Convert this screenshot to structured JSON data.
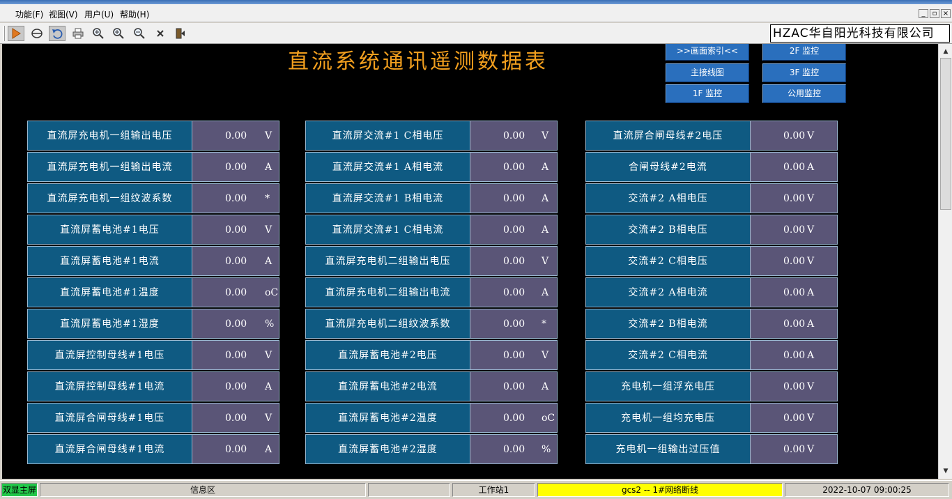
{
  "menu": {
    "items": [
      "功能(F)",
      "视图(V)",
      "用户(U)",
      "帮助(H)"
    ],
    "window_controls": [
      "_",
      "▫",
      "×"
    ]
  },
  "toolbar": {
    "company": "HZAC华自阳光科技有限公司",
    "buttons": [
      "run-icon",
      "view-icon",
      "undo-icon",
      "print-icon",
      "zoom-icon",
      "zoom-in-icon",
      "zoom-out-icon",
      "close-x-icon",
      "exit-door-icon"
    ]
  },
  "page": {
    "title": "直流系统通讯遥测数据表"
  },
  "nav": {
    "index": ">>画面索引<<",
    "floor2": "2F 监控",
    "main_wiring": "主接线图",
    "floor3": "3F 监控",
    "floor1": "1F 监控",
    "public": "公用监控"
  },
  "tables": [
    {
      "rows": [
        {
          "label": "直流屏充电机一组输出电压",
          "value": "0.00",
          "unit": "V"
        },
        {
          "label": "直流屏充电机一组输出电流",
          "value": "0.00",
          "unit": "A"
        },
        {
          "label": "直流屏充电机一组纹波系数",
          "value": "0.00",
          "unit": "*"
        },
        {
          "label": "直流屏蓄电池#1电压",
          "value": "0.00",
          "unit": "V"
        },
        {
          "label": "直流屏蓄电池#1电流",
          "value": "0.00",
          "unit": "A"
        },
        {
          "label": "直流屏蓄电池#1温度",
          "value": "0.00",
          "unit": "oC"
        },
        {
          "label": "直流屏蓄电池#1湿度",
          "value": "0.00",
          "unit": "%"
        },
        {
          "label": "直流屏控制母线#1电压",
          "value": "0.00",
          "unit": "V"
        },
        {
          "label": "直流屏控制母线#1电流",
          "value": "0.00",
          "unit": "A"
        },
        {
          "label": "直流屏合闸母线#1电压",
          "value": "0.00",
          "unit": "V"
        },
        {
          "label": "直流屏合闸母线#1电流",
          "value": "0.00",
          "unit": "A"
        }
      ]
    },
    {
      "rows": [
        {
          "label": "直流屏交流#1 C相电压",
          "value": "0.00",
          "unit": "V"
        },
        {
          "label": "直流屏交流#1 A相电流",
          "value": "0.00",
          "unit": "A"
        },
        {
          "label": "直流屏交流#1 B相电流",
          "value": "0.00",
          "unit": "A"
        },
        {
          "label": "直流屏交流#1 C相电流",
          "value": "0.00",
          "unit": "A"
        },
        {
          "label": "直流屏充电机二组输出电压",
          "value": "0.00",
          "unit": "V"
        },
        {
          "label": "直流屏充电机二组输出电流",
          "value": "0.00",
          "unit": "A"
        },
        {
          "label": "直流屏充电机二组纹波系数",
          "value": "0.00",
          "unit": "*"
        },
        {
          "label": "直流屏蓄电池#2电压",
          "value": "0.00",
          "unit": "V"
        },
        {
          "label": "直流屏蓄电池#2电流",
          "value": "0.00",
          "unit": "A"
        },
        {
          "label": "直流屏蓄电池#2温度",
          "value": "0.00",
          "unit": "oC"
        },
        {
          "label": "直流屏蓄电池#2湿度",
          "value": "0.00",
          "unit": "%"
        }
      ]
    },
    {
      "rows": [
        {
          "label": "直流屏合闸母线#2电压",
          "value": "0.00",
          "unit": "V"
        },
        {
          "label": "合闸母线#2电流",
          "value": "0.00",
          "unit": "A"
        },
        {
          "label": "交流#2 A相电压",
          "value": "0.00",
          "unit": "V"
        },
        {
          "label": "交流#2 B相电压",
          "value": "0.00",
          "unit": "V"
        },
        {
          "label": "交流#2 C相电压",
          "value": "0.00",
          "unit": "V"
        },
        {
          "label": "交流#2 A相电流",
          "value": "0.00",
          "unit": "A"
        },
        {
          "label": "交流#2 B相电流",
          "value": "0.00",
          "unit": "A"
        },
        {
          "label": "交流#2 C相电流",
          "value": "0.00",
          "unit": "A"
        },
        {
          "label": "充电机一组浮充电压",
          "value": "0.00",
          "unit": "V"
        },
        {
          "label": "充电机一组均充电压",
          "value": "0.00",
          "unit": "V"
        },
        {
          "label": "充电机一组输出过压值",
          "value": "0.00",
          "unit": "V"
        }
      ]
    }
  ],
  "status": {
    "screen_mode": "双显主屏",
    "info_area": "信息区",
    "workstation": "工作站1",
    "network_alarm": "gcs2 -- 1#网络断线",
    "datetime": "2022-10-07 09:00:25"
  },
  "colors": {
    "title": "#f29f1e",
    "label_cell": "#0f5a82",
    "value_cell": "#5a5577",
    "nav_button": "#2a6fbd",
    "status_green": "#22c84a",
    "status_yellow": "#ffff00"
  }
}
